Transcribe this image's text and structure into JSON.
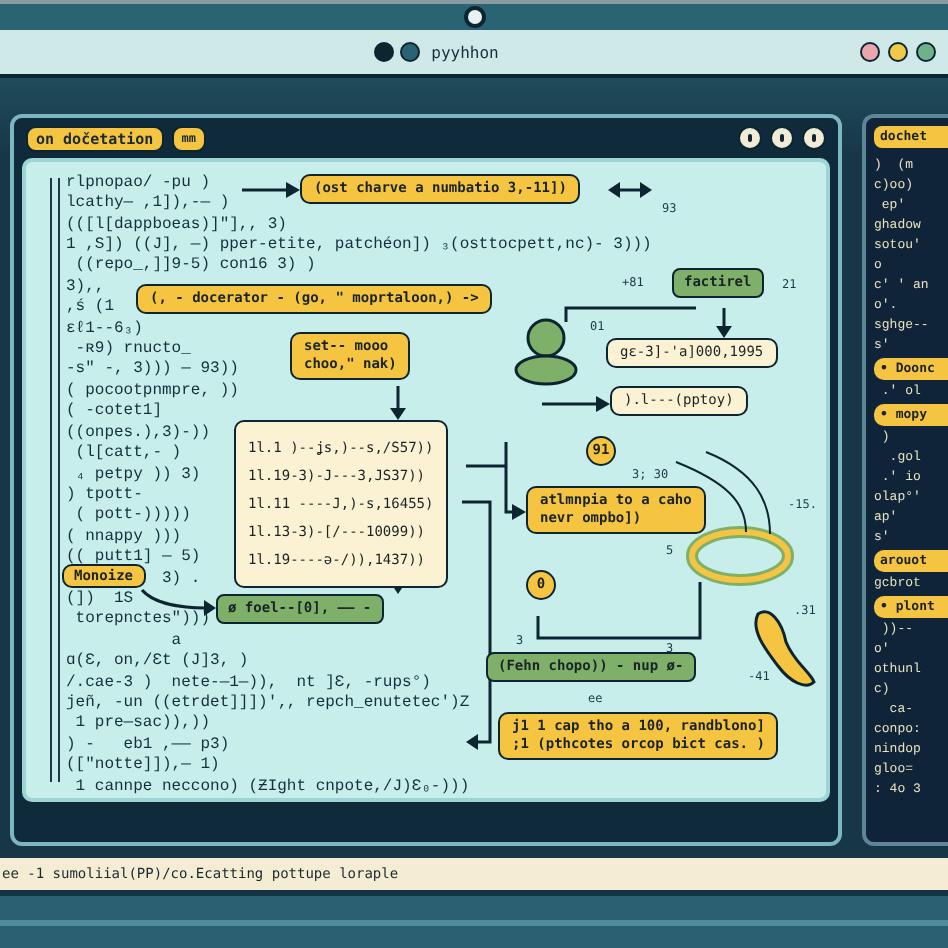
{
  "window": {
    "title": "pyyhhon"
  },
  "editor": {
    "tags": [
      "on dočetation",
      "mm"
    ],
    "code_lines": [
      "rlpnopao/ -pu )",
      "lcathy— ,1]),-— )",
      "(([l[dappboeas)]\"],, 3)",
      "1 ,S]) ((J], —) pper-etite, patchéon]) ₃(osttocpett,nc)- 3)))",
      " ((repo_,]]9-5) con16 3) )",
      "3),,",
      ",ś (1",
      "ɛℓ1--6₃)",
      " -ʀ9) rnucto_",
      "-s\" -, 3))) — 93))",
      "( pocootpnmpre, ))",
      "( -cotet1]",
      "((onpes.),3)-))",
      " (l[catt,- )",
      " ₄ petpy )) 3)",
      ") tpott-",
      " ( pott-)))))",
      "( nnappy )))",
      "(( putt1] — 5)",
      "3) .",
      "(])  1S",
      " torepnctes\")))",
      "           a",
      "ɑ(Ɛ, on,/Ɛt (J]3, )",
      "/.cae-3 )  nete-—1—)),  nt ]Ɛ, -rups°)",
      "jeñ, -un ((etrdet]]])'‚, repch_enutetec')Z",
      " 1 pre—sac)),))",
      ") -   eb1 ,—— p3)",
      "([\"notte]]),— 1)",
      " 1 cannpe neccono) (ƵIght cnpote,/J)Ɛ₀-)))"
    ],
    "diagram": {
      "nodes": [
        {
          "kind": "note",
          "lines": [
            "(ost charve a numbatio 3,-11])"
          ]
        },
        {
          "kind": "note",
          "lines": [
            "(, - docerator - (go, \" moprtaloon,) ->"
          ]
        },
        {
          "kind": "step",
          "lines": [
            "factirel"
          ]
        },
        {
          "kind": "note",
          "lines": [
            "set-- mooo",
            "choo,\" nak)"
          ]
        },
        {
          "kind": "output",
          "lines": [
            "1l.1 )--ʝs,)--s,/S57))",
            "1l.19-3)-J---3,JS37))",
            "1l.11 ----J,)-s,16455)",
            "1l.13-3)-[/---10099))",
            "1l.19----ə-/)),1437))"
          ]
        },
        {
          "kind": "note",
          "lines": [
            "Monoize"
          ]
        },
        {
          "kind": "step",
          "lines": [
            "ø foel--[0], —— -"
          ]
        },
        {
          "kind": "output",
          "lines": [
            "gɛ-3]-'a]000,1995"
          ]
        },
        {
          "kind": "output",
          "lines": [
            ").l---(pptoy)"
          ]
        },
        {
          "kind": "badge",
          "lines": [
            "91"
          ]
        },
        {
          "kind": "note",
          "lines": [
            "atlmnpia to a caho",
            "nevr ompbo])"
          ]
        },
        {
          "kind": "badge",
          "lines": [
            "0"
          ]
        },
        {
          "kind": "step",
          "lines": [
            "(Fehn chopo)) - nup ø-"
          ]
        },
        {
          "kind": "note",
          "lines": [
            "j1 1 cap tho a 100, randblono]",
            ";1 (pthcotes orcop bict cas. )"
          ]
        }
      ],
      "labels": [
        "93",
        "+81",
        "21",
        "01",
        "3; 30",
        "-15.",
        "5",
        ".31",
        "-41",
        "ee",
        "3",
        "3"
      ]
    }
  },
  "side_panel": {
    "title": "dochet",
    "lines": [
      {
        "kind": "code",
        "text": ")  (m"
      },
      {
        "kind": "code",
        "text": "c)oo)"
      },
      {
        "kind": "code",
        "text": " ep'"
      },
      {
        "kind": "code",
        "text": "ghadow"
      },
      {
        "kind": "code",
        "text": "sotou'"
      },
      {
        "kind": "code",
        "text": "o"
      },
      {
        "kind": "code",
        "text": "c' ' an"
      },
      {
        "kind": "code",
        "text": "o'."
      },
      {
        "kind": "code",
        "text": "sghge--"
      },
      {
        "kind": "code",
        "text": "s'"
      },
      {
        "kind": "pill",
        "text": "• Doonc"
      },
      {
        "kind": "code",
        "text": " .' ol"
      },
      {
        "kind": "pill",
        "text": "• mopy"
      },
      {
        "kind": "code",
        "text": " )"
      },
      {
        "kind": "code",
        "text": "  .gol"
      },
      {
        "kind": "code",
        "text": " .' io"
      },
      {
        "kind": "code",
        "text": "olap°'"
      },
      {
        "kind": "code",
        "text": "ap'"
      },
      {
        "kind": "code",
        "text": "s'"
      },
      {
        "kind": "pill",
        "text": "arouot"
      },
      {
        "kind": "code",
        "text": "gcbrot"
      },
      {
        "kind": "pill",
        "text": "• plont"
      },
      {
        "kind": "code",
        "text": " ))--"
      },
      {
        "kind": "code",
        "text": "o'"
      },
      {
        "kind": "code",
        "text": "othunl"
      },
      {
        "kind": "code",
        "text": "c)"
      },
      {
        "kind": "code",
        "text": "  ca-"
      },
      {
        "kind": "code",
        "text": "conpo:"
      },
      {
        "kind": "code",
        "text": "nindop"
      },
      {
        "kind": "code",
        "text": "gloo="
      },
      {
        "kind": "code",
        "text": ": 4o 3"
      }
    ]
  },
  "status_bar": "ee -1 sumoliial(PP)/co.Ecatting pottupe loraple"
}
